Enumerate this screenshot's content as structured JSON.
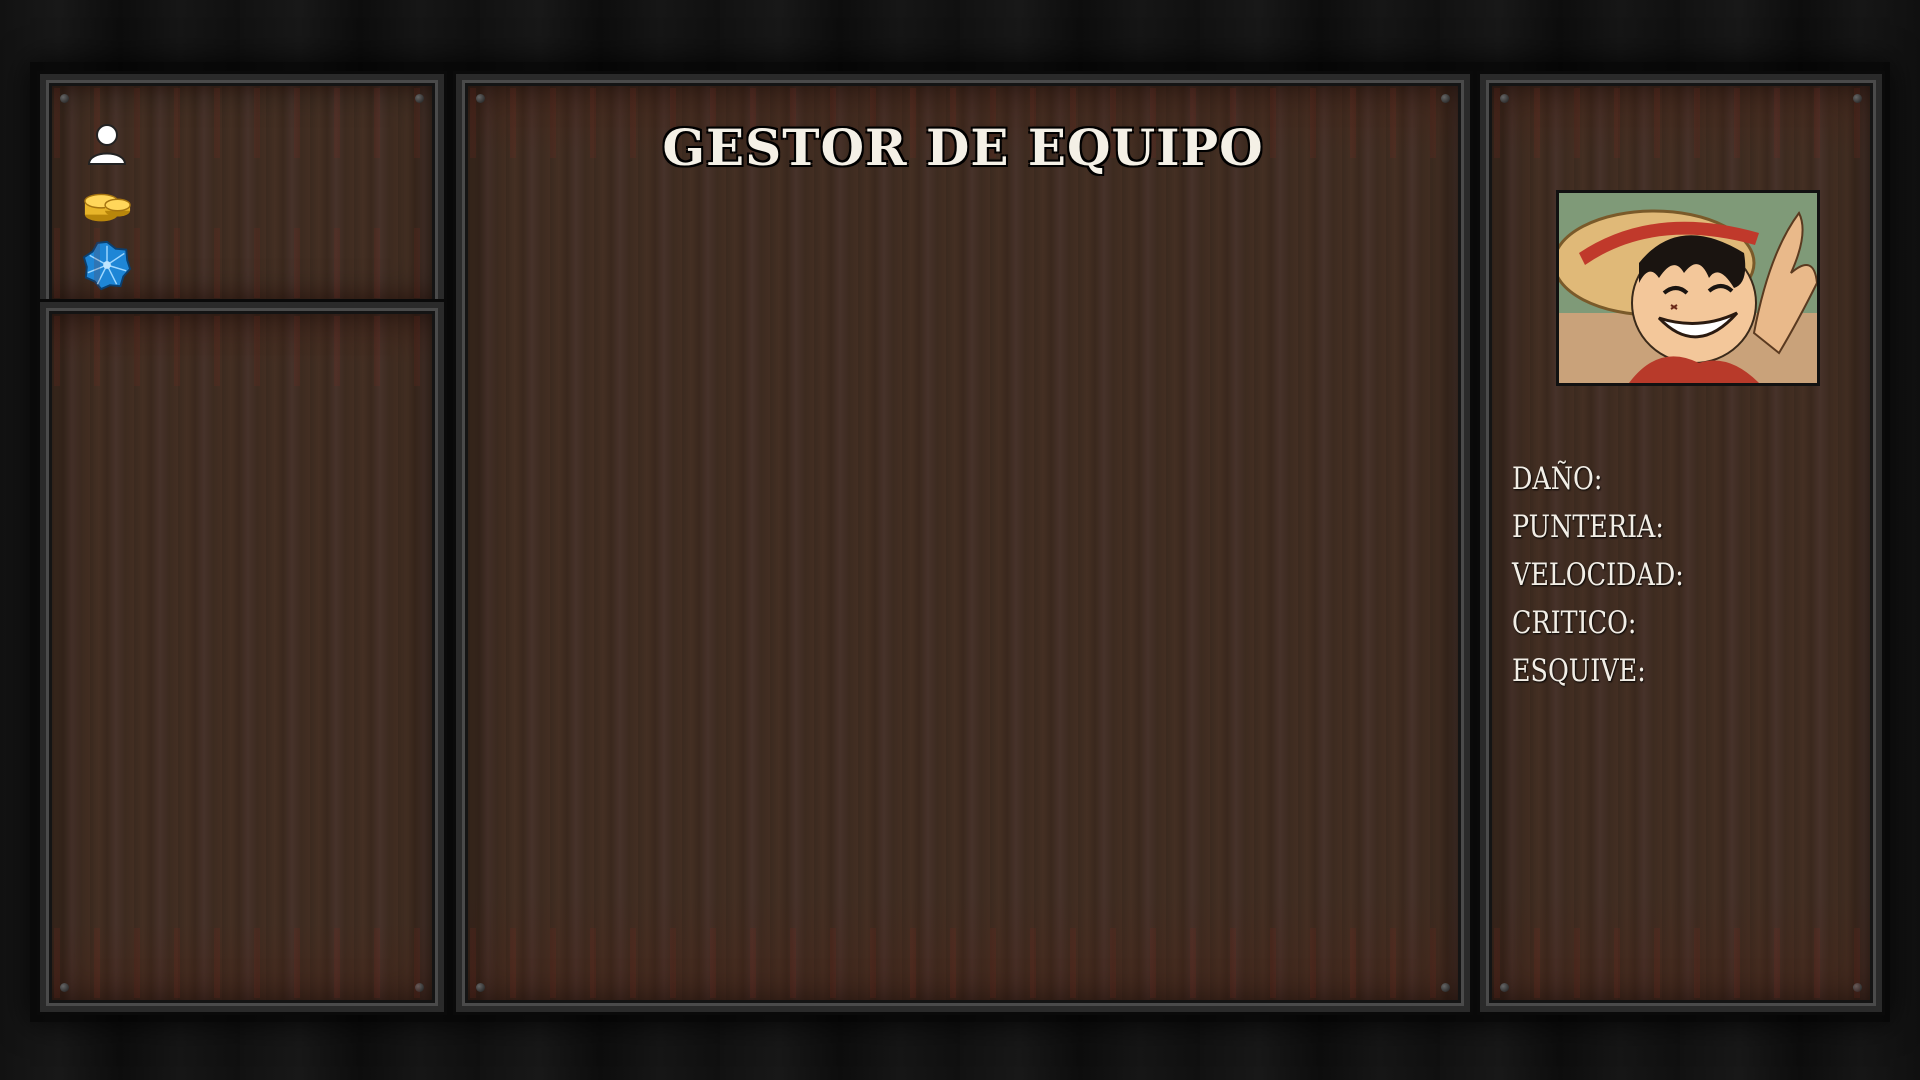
{
  "screen": {
    "title": "GESTOR DE EQUIPO"
  },
  "resources": [
    {
      "icon": "user-icon",
      "value": ""
    },
    {
      "icon": "gold-coins-icon",
      "value": ""
    },
    {
      "icon": "blue-gem-icon",
      "value": ""
    }
  ],
  "character": {
    "portrait": "straw-hat-character-portrait",
    "stats": [
      {
        "label": "DAÑO:",
        "value": ""
      },
      {
        "label": "PUNTERIA:",
        "value": ""
      },
      {
        "label": "VELOCIDAD:",
        "value": ""
      },
      {
        "label": "CRITICO:",
        "value": ""
      },
      {
        "label": "ESQUIVE:",
        "value": ""
      }
    ]
  },
  "colors": {
    "wood": "#3f2c21",
    "frame": "#2a2a2a",
    "text": "#f4f0e6",
    "gold": "#e8b52a",
    "gem": "#2a9ee0"
  }
}
